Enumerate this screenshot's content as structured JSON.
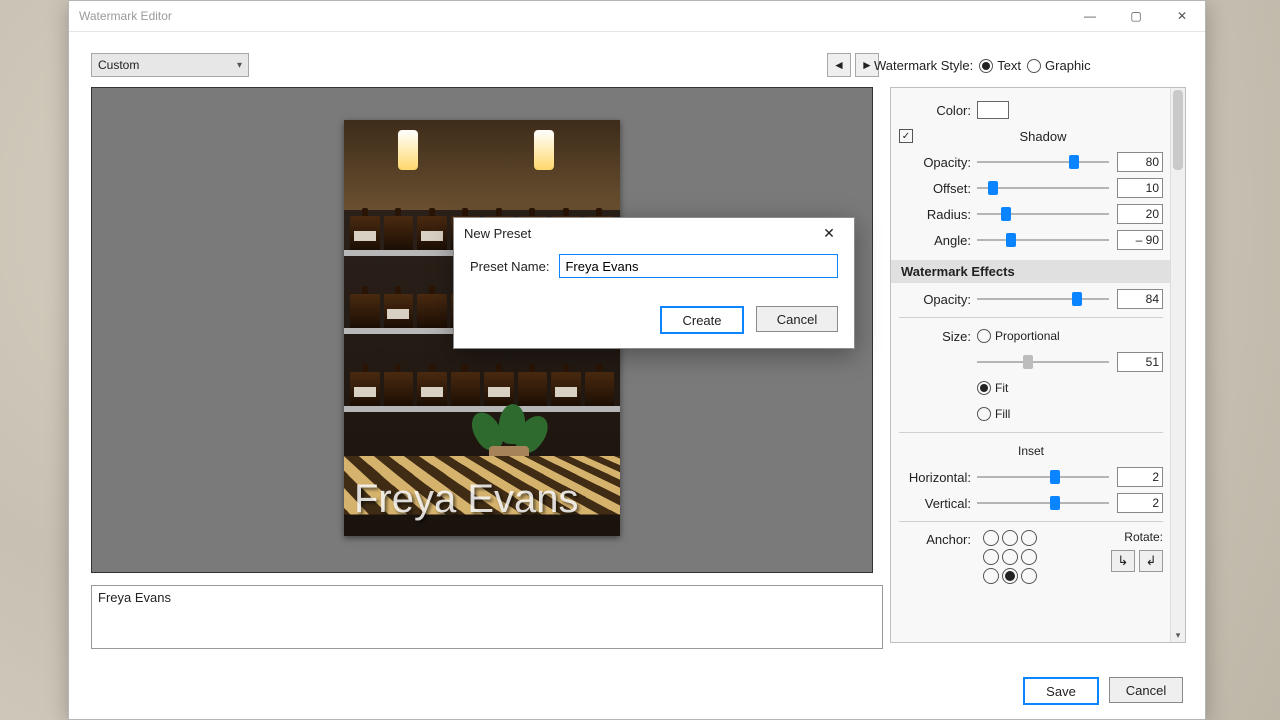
{
  "window": {
    "title": "Watermark Editor"
  },
  "preset": {
    "selected": "Custom"
  },
  "watermarkStyle": {
    "label": "Watermark Style:",
    "text": "Text",
    "graphic": "Graphic",
    "selected": "text"
  },
  "side": {
    "colorLabel": "Color:",
    "shadow": {
      "label": "Shadow",
      "opacity": {
        "label": "Opacity:",
        "value": "80",
        "pos": 70
      },
      "offset": {
        "label": "Offset:",
        "value": "10",
        "pos": 8
      },
      "radius": {
        "label": "Radius:",
        "value": "20",
        "pos": 18
      },
      "angle": {
        "label": "Angle:",
        "value": "– 90",
        "pos": 22
      }
    },
    "effects": {
      "header": "Watermark Effects",
      "opacity": {
        "label": "Opacity:",
        "value": "84",
        "pos": 72
      }
    },
    "size": {
      "label": "Size:",
      "proportional": "Proportional",
      "fit": "Fit",
      "fill": "Fill",
      "value": "51",
      "pos": 35
    },
    "inset": {
      "label": "Inset",
      "horizontal": {
        "label": "Horizontal:",
        "value": "2",
        "pos": 55
      },
      "vertical": {
        "label": "Vertical:",
        "value": "2",
        "pos": 55
      }
    },
    "anchor": {
      "label": "Anchor:"
    },
    "rotate": {
      "label": "Rotate:"
    }
  },
  "watermarkText": "Freya Evans",
  "footer": {
    "save": "Save",
    "cancel": "Cancel"
  },
  "modal": {
    "title": "New Preset",
    "nameLabel": "Preset Name:",
    "nameValue": "Freya Evans",
    "create": "Create",
    "cancel": "Cancel"
  }
}
